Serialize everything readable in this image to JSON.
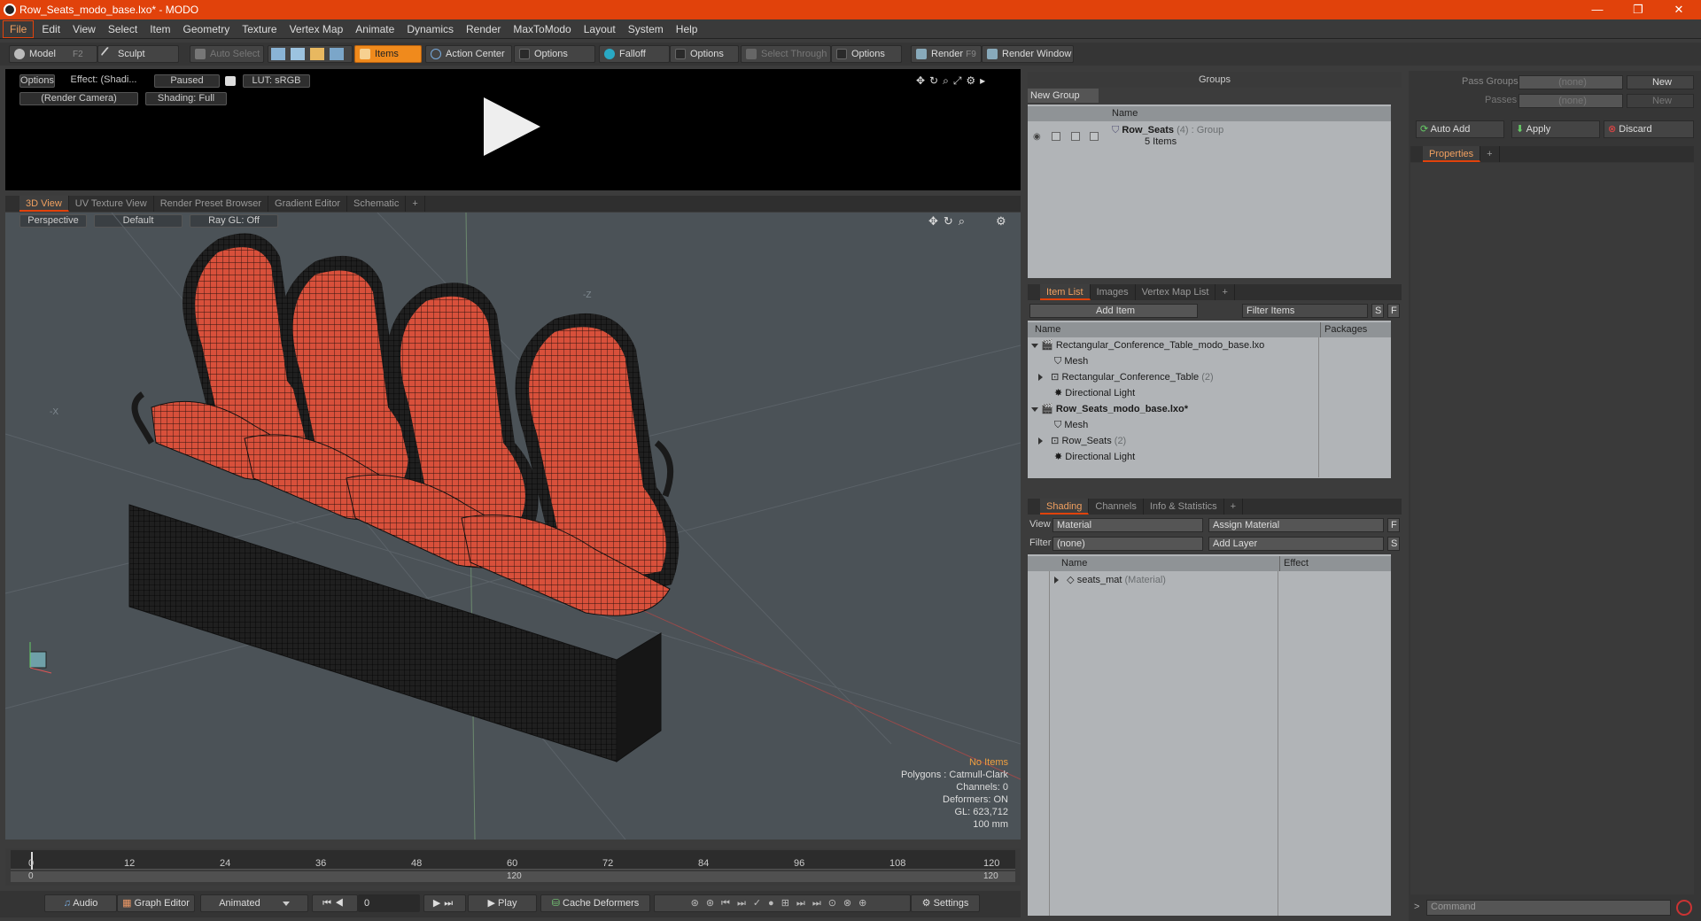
{
  "window": {
    "title": "Row_Seats_modo_base.lxo* - MODO",
    "minimize": "—",
    "restore": "❐",
    "close": "✕"
  },
  "menu": [
    "File",
    "Edit",
    "View",
    "Select",
    "Item",
    "Geometry",
    "Texture",
    "Vertex Map",
    "Animate",
    "Dynamics",
    "Render",
    "MaxToModo",
    "Layout",
    "System",
    "Help"
  ],
  "toolbar": {
    "model": "Model",
    "model_key": "F2",
    "sculpt": "Sculpt",
    "auto_select": "Auto Select",
    "items": "Items",
    "action_center": "Action Center",
    "options1": "Options",
    "falloff": "Falloff",
    "options2": "Options",
    "select_through": "Select Through",
    "options3": "Options",
    "render": "Render",
    "render_key": "F9",
    "render_window": "Render Window"
  },
  "preview": {
    "options": "Options",
    "effect": "Effect: (Shadi...",
    "paused": "Paused",
    "lut": "LUT: sRGB",
    "camera": "(Render Camera)",
    "shading": "Shading: Full"
  },
  "viewport_tabs": [
    "3D View",
    "UV Texture View",
    "Render Preset Browser",
    "Gradient Editor",
    "Schematic",
    "+"
  ],
  "viewport": {
    "perspective": "Perspective",
    "default": "Default",
    "raygl": "Ray GL: Off",
    "axis_z": "-Z",
    "axis_x": "-X",
    "info": {
      "no_items": "No Items",
      "polygons": "Polygons : Catmull-Clark",
      "channels": "Channels: 0",
      "deformers": "Deformers: ON",
      "gl": "GL: 623,712",
      "scale": "100 mm"
    }
  },
  "timeline": {
    "ticks": [
      "0",
      "12",
      "24",
      "36",
      "48",
      "60",
      "72",
      "84",
      "96",
      "108",
      "120"
    ],
    "range_start": "0",
    "range_mid": "120",
    "range_end": "120"
  },
  "bottombar": {
    "audio": "Audio",
    "graph_editor": "Graph Editor",
    "animated": "Animated",
    "frame": "0",
    "play": "Play",
    "cache_deformers": "Cache Deformers",
    "settings": "Settings"
  },
  "groups": {
    "title": "Groups",
    "new_group": "New Group",
    "col_name": "Name",
    "row_name": "Row_Seats",
    "row_count": "(4)",
    "row_type": ": Group",
    "row_sub": "5 Items"
  },
  "item_tabs": [
    "Item List",
    "Images",
    "Vertex Map List",
    "+"
  ],
  "item_list": {
    "add_item": "Add Item",
    "filter_items": "Filter Items",
    "s": "S",
    "f": "F",
    "col_name": "Name",
    "col_packages": "Packages",
    "rows": [
      {
        "label": "Rectangular_Conference_Table_modo_base.lxo",
        "extra": ""
      },
      {
        "label": "Mesh",
        "extra": ""
      },
      {
        "label": "Rectangular_Conference_Table",
        "extra": "(2)"
      },
      {
        "label": "Directional Light",
        "extra": ""
      },
      {
        "label": "Row_Seats_modo_base.lxo*",
        "extra": ""
      },
      {
        "label": "Mesh",
        "extra": ""
      },
      {
        "label": "Row_Seats",
        "extra": "(2)"
      },
      {
        "label": "Directional Light",
        "extra": ""
      }
    ]
  },
  "shading_tabs": [
    "Shading",
    "Channels",
    "Info & Statistics",
    "+"
  ],
  "shading": {
    "view_label": "View",
    "view_value": "Material",
    "assign_material": "Assign Material",
    "f": "F",
    "filter_label": "Filter",
    "filter_value": "(none)",
    "add_layer": "Add Layer",
    "s": "S",
    "col_name": "Name",
    "col_effect": "Effect",
    "row_name": "seats_mat",
    "row_type": "(Material)"
  },
  "right": {
    "pass_groups": "Pass Groups",
    "pass_groups_value": "(none)",
    "new1": "New",
    "passes": "Passes",
    "passes_value": "(none)",
    "new2": "New",
    "auto_add": "Auto Add",
    "apply": "Apply",
    "discard": "Discard",
    "properties": "Properties",
    "plus": "+",
    "command": "Command"
  },
  "colors": {
    "accent": "#e1420b",
    "active_button": "#f08a1c",
    "seat_red": "#d8503b"
  }
}
